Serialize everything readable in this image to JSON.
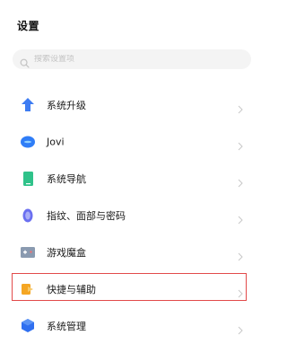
{
  "header": {
    "title": "设置"
  },
  "search": {
    "placeholder": "搜索设置项",
    "icon": "search-icon"
  },
  "items": [
    {
      "label": "系统升级",
      "icon": "arrow-up-icon",
      "color": "#3d7cf2",
      "highlighted": false
    },
    {
      "label": "Jovi",
      "icon": "jovi-icon",
      "color": "#2f7df7",
      "highlighted": false
    },
    {
      "label": "系统导航",
      "icon": "phone-icon",
      "color": "#2fc28a",
      "highlighted": false
    },
    {
      "label": "指纹、面部与密码",
      "icon": "fingerprint-icon",
      "color": "#6a6ff0",
      "highlighted": false
    },
    {
      "label": "游戏魔盒",
      "icon": "game-box-icon",
      "color": "#8a9ab0",
      "highlighted": false
    },
    {
      "label": "快捷与辅助",
      "icon": "shortcut-icon",
      "color": "#f5a623",
      "highlighted": true
    },
    {
      "label": "系统管理",
      "icon": "system-manage-icon",
      "color": "#2f6ff0",
      "highlighted": false
    }
  ],
  "colors": {
    "highlight_border": "#e24a4a",
    "chevron": "#c8c8c8"
  }
}
